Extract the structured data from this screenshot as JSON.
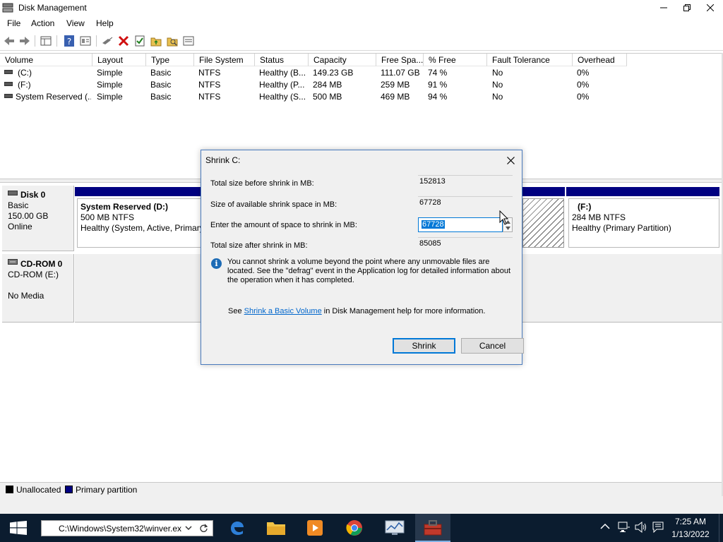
{
  "window": {
    "title": "Disk Management"
  },
  "menu": [
    "File",
    "Action",
    "View",
    "Help"
  ],
  "columns": [
    "Volume",
    "Layout",
    "Type",
    "File System",
    "Status",
    "Capacity",
    "Free Spa...",
    "% Free",
    "Fault Tolerance",
    "Overhead"
  ],
  "volumes": [
    {
      "volume": "(C:)",
      "layout": "Simple",
      "type": "Basic",
      "fs": "NTFS",
      "status": "Healthy (B...",
      "capacity": "149.23 GB",
      "free": "111.07 GB",
      "pct": "74 %",
      "fault": "No",
      "overhead": "0%"
    },
    {
      "volume": "(F:)",
      "layout": "Simple",
      "type": "Basic",
      "fs": "NTFS",
      "status": "Healthy (P...",
      "capacity": "284 MB",
      "free": "259 MB",
      "pct": "91 %",
      "fault": "No",
      "overhead": "0%"
    },
    {
      "volume": "System Reserved (...",
      "layout": "Simple",
      "type": "Basic",
      "fs": "NTFS",
      "status": "Healthy (S...",
      "capacity": "500 MB",
      "free": "469 MB",
      "pct": "94 %",
      "fault": "No",
      "overhead": "0%"
    }
  ],
  "disk0": {
    "name": "Disk 0",
    "kind": "Basic",
    "size": "150.00 GB",
    "state": "Online",
    "partitions": [
      {
        "name": "System Reserved  (D:)",
        "fs": "500 MB NTFS",
        "status": "Healthy (System, Active, Primary"
      },
      {
        "name": "(F:)",
        "fs": "284 MB NTFS",
        "status": "Healthy (Primary Partition)"
      }
    ]
  },
  "cdrom0": {
    "name": "CD-ROM 0",
    "drive": "CD-ROM (E:)",
    "media": "No Media"
  },
  "legend": [
    {
      "label": "Unallocated",
      "color": "#000000"
    },
    {
      "label": "Primary partition",
      "color": "#000080"
    }
  ],
  "dialog": {
    "title": "Shrink C:",
    "rows": [
      {
        "label": "Total size before shrink in MB:",
        "value": "152813"
      },
      {
        "label": "Size of available shrink space in MB:",
        "value": "67728"
      },
      {
        "label": "Enter the amount of space to shrink in MB:",
        "value": "67728"
      },
      {
        "label": "Total size after shrink in MB:",
        "value": "85085"
      }
    ],
    "info": "You cannot shrink a volume beyond the point where any unmovable files are located. See the \"defrag\" event in the Application log for detailed information about the operation when it has completed.",
    "help_prefix": "See",
    "help_link": "Shrink a Basic Volume",
    "help_suffix": "in Disk Management help for more information.",
    "shrink_label": "Shrink",
    "cancel_label": "Cancel"
  },
  "taskbar": {
    "run_value": "C:\\Windows\\System32\\winver.ex",
    "time": "7:25 AM",
    "date": "1/13/2022"
  },
  "colors": {
    "primary_partition": "#000080",
    "taskbar": "#0b1c2f",
    "accent": "#0078d7"
  }
}
